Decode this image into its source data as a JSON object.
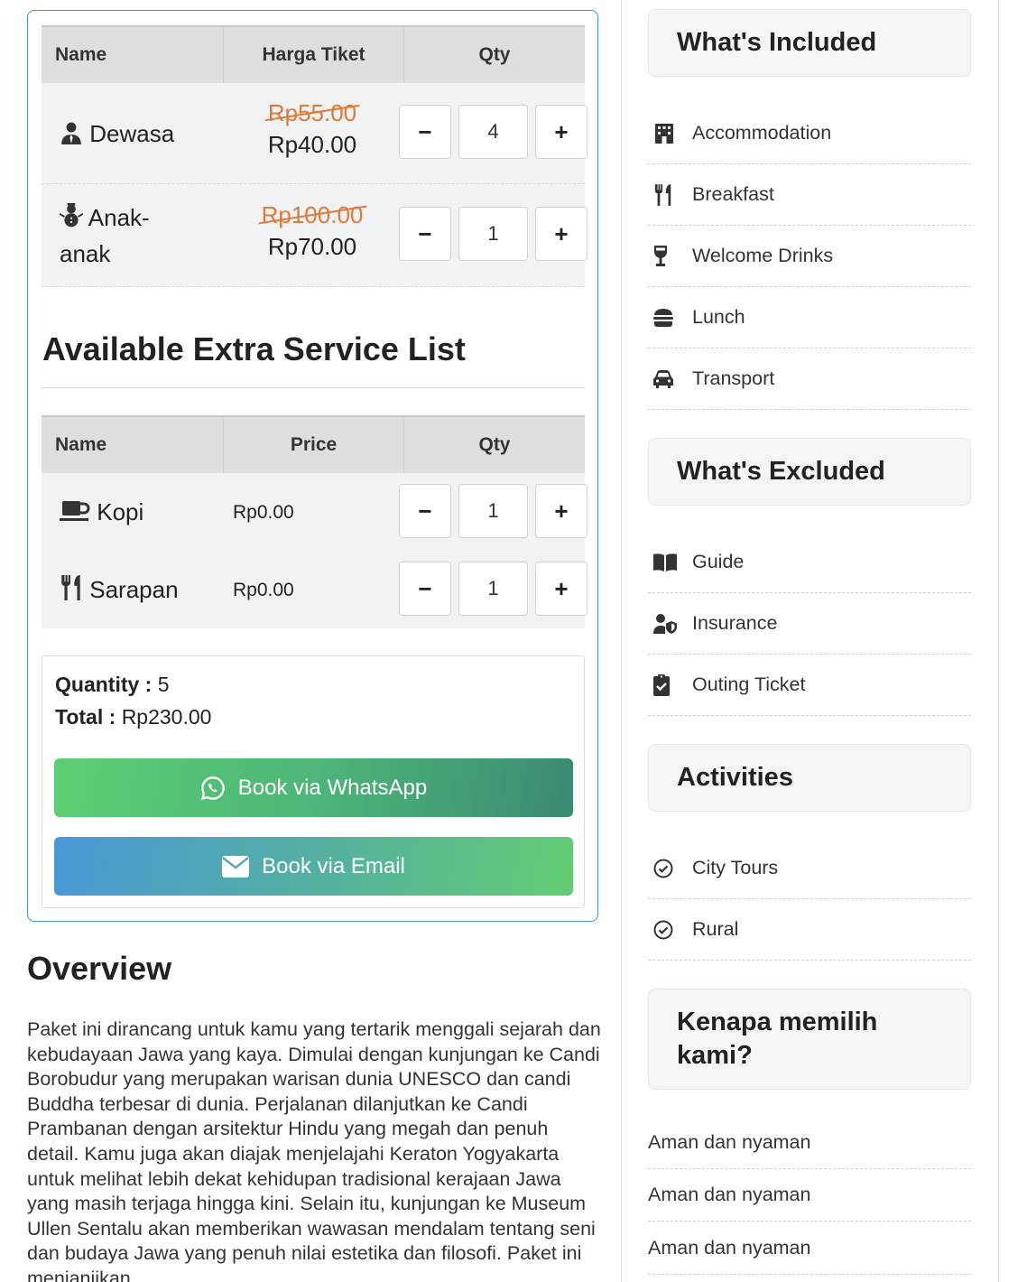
{
  "ticket_table": {
    "headers": [
      "Name",
      "Harga Tiket",
      "Qty"
    ],
    "rows": [
      {
        "icon": "person-tie-icon",
        "name": "Dewasa",
        "old_price": "Rp55.00",
        "price": "Rp40.00",
        "qty": "4"
      },
      {
        "icon": "snowman-icon",
        "name_line1": "Anak-",
        "name_line2": "anak",
        "old_price": "Rp100.00",
        "price": "Rp70.00",
        "qty": "1"
      }
    ]
  },
  "extra_service": {
    "title": "Available Extra Service List",
    "headers": [
      "Name",
      "Price",
      "Qty"
    ],
    "rows": [
      {
        "icon": "mug-icon",
        "name": "Kopi",
        "price": "Rp0.00",
        "qty": "1"
      },
      {
        "icon": "utensils-icon",
        "name": "Sarapan",
        "price": "Rp0.00",
        "qty": "1"
      }
    ]
  },
  "stepper": {
    "minus": "−",
    "plus": "+"
  },
  "summary": {
    "quantity_label": "Quantity :",
    "quantity_value": "5",
    "total_label": "Total :",
    "total_value": "Rp230.00",
    "whatsapp_button": "Book via WhatsApp",
    "email_button": "Book via Email"
  },
  "overview": {
    "title": "Overview",
    "text": "Paket ini dirancang untuk kamu yang tertarik menggali sejarah dan kebudayaan Jawa yang kaya. Dimulai dengan kunjungan ke Candi Borobudur yang merupakan warisan dunia UNESCO dan candi Buddha terbesar di dunia. Perjalanan dilanjutkan ke Candi Prambanan dengan arsitektur Hindu yang megah dan penuh detail. Kamu juga akan diajak menjelajahi Keraton Yogyakarta untuk melihat lebih dekat kehidupan tradisional kerajaan Jawa yang masih terjaga hingga kini. Selain itu, kunjungan ke Museum Ullen Sentalu akan memberikan wawasan mendalam tentang seni dan budaya Jawa yang penuh nilai estetika dan filosofi. Paket ini menjanjikan"
  },
  "sidebar": {
    "included": {
      "title": "What's Included",
      "items": [
        {
          "icon": "building-icon",
          "label": "Accommodation"
        },
        {
          "icon": "utensils-icon",
          "label": "Breakfast"
        },
        {
          "icon": "wine-glass-icon",
          "label": "Welcome Drinks"
        },
        {
          "icon": "burger-icon",
          "label": "Lunch"
        },
        {
          "icon": "car-icon",
          "label": "Transport"
        }
      ]
    },
    "excluded": {
      "title": "What's Excluded",
      "items": [
        {
          "icon": "book-icon",
          "label": "Guide"
        },
        {
          "icon": "user-shield-icon",
          "label": "Insurance"
        },
        {
          "icon": "clipboard-check-icon",
          "label": "Outing Ticket"
        }
      ]
    },
    "activities": {
      "title": "Activities",
      "items": [
        {
          "icon": "check-circle-icon",
          "label": "City Tours"
        },
        {
          "icon": "check-circle-icon",
          "label": "Rural"
        }
      ]
    },
    "why": {
      "title_line1": "Kenapa memilih",
      "title_line2": "kami?",
      "items": [
        "Aman dan nyaman",
        "Aman dan nyaman",
        "Aman dan nyaman"
      ]
    }
  }
}
